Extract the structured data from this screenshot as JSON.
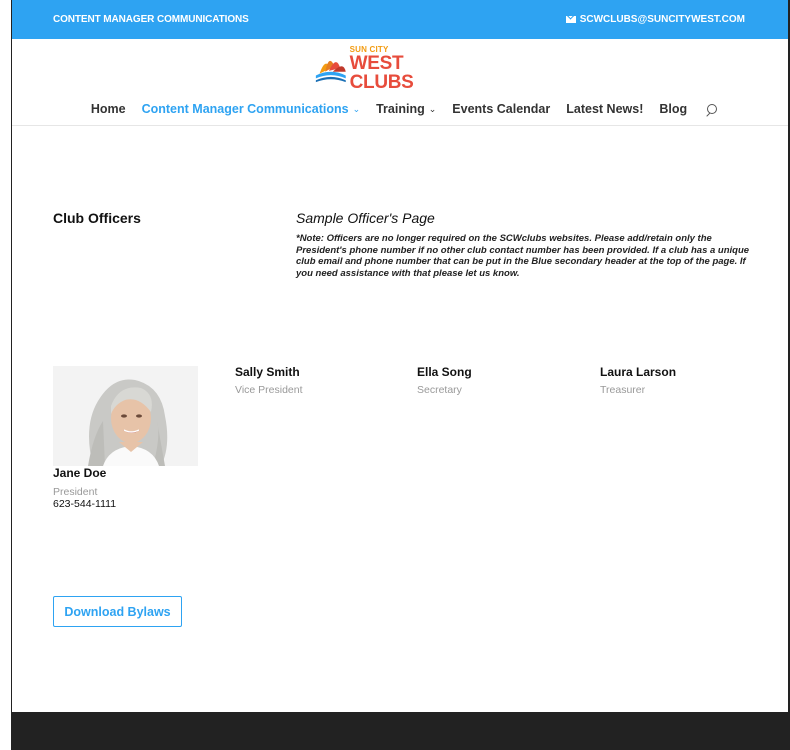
{
  "topbar": {
    "left_text": "CONTENT MANAGER COMMUNICATIONS",
    "email": "SCWCLUBS@SUNCITYWEST.COM",
    "email_icon": "mail-icon",
    "bg_color": "#2ea3f2"
  },
  "logo": {
    "small": "SUN CITY",
    "big": "WEST CLUBS"
  },
  "nav": {
    "items": [
      {
        "label": "Home"
      },
      {
        "label": "Content Manager Communications",
        "chevron": "⌄"
      },
      {
        "label": "Training",
        "chevron": "⌄"
      },
      {
        "label": "Events Calendar"
      },
      {
        "label": "Latest News!"
      },
      {
        "label": "Blog"
      }
    ],
    "search_icon": "search-icon"
  },
  "main": {
    "heading": "Club Officers",
    "sample_title": "Sample Officer's Page",
    "note": "*Note: Officers are no longer required on the SCWclubs websites.  Please add/retain only the President's phone number if no other club contact number has been provided.  If a club has a unique club email and phone number that can be put in the Blue secondary header at the top of the page. If you need assistance with that please let us know."
  },
  "officers": [
    {
      "name": "Jane Doe",
      "role": "President",
      "phone": "623-544-1111"
    },
    {
      "name": "Sally Smith",
      "role": "Vice President"
    },
    {
      "name": "Ella Song",
      "role": "Secretary"
    },
    {
      "name": "Laura Larson",
      "role": "Treasurer"
    }
  ],
  "bylaws_button": "Download Bylaws",
  "colors": {
    "accent": "#2ea3f2",
    "footer": "#222222",
    "muted": "#999999"
  }
}
